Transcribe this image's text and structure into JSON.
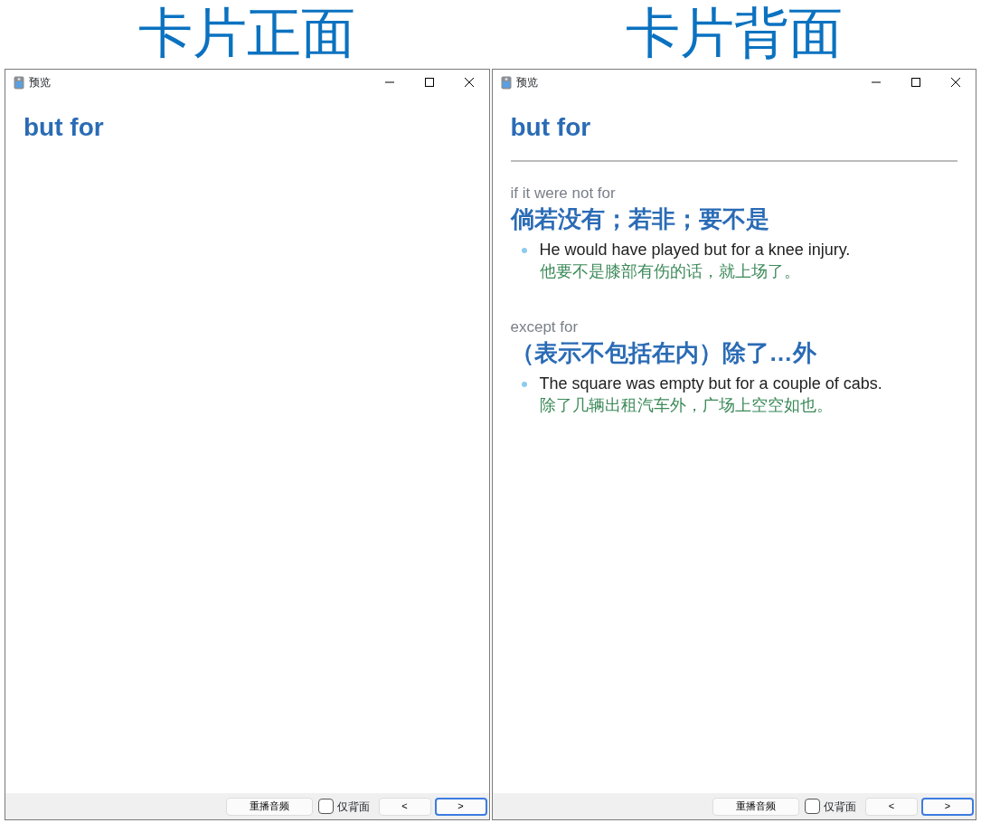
{
  "panels": [
    {
      "caption": "卡片正面",
      "window": {
        "title": "预览"
      },
      "card": {
        "word": "but for"
      },
      "footer": {
        "replay": "重播音频",
        "back_only": {
          "label": "仅背面",
          "checked": false
        },
        "buttons": [
          {
            "label": "<",
            "focused": false
          },
          {
            "label": ">",
            "focused": true
          }
        ]
      }
    },
    {
      "caption": "卡片背面",
      "window": {
        "title": "预览"
      },
      "card": {
        "word": "but for",
        "definitions": [
          {
            "sense": "if it were not for",
            "meaning": "倘若没有；若非；要不是",
            "examples": [
              {
                "en": "He would have played but for a knee injury.",
                "zh": "他要不是膝部有伤的话，就上场了。"
              }
            ]
          },
          {
            "sense": "except for",
            "meaning": "（表示不包括在内）除了…外",
            "examples": [
              {
                "en": "The square was empty but for a couple of cabs.",
                "zh": "除了几辆出租汽车外，广场上空空如也。"
              }
            ]
          }
        ]
      },
      "footer": {
        "replay": "重播音频",
        "back_only": {
          "label": "仅背面",
          "checked": false
        },
        "buttons": [
          {
            "label": "<",
            "focused": false
          },
          {
            "label": ">",
            "focused": true
          }
        ]
      }
    }
  ]
}
